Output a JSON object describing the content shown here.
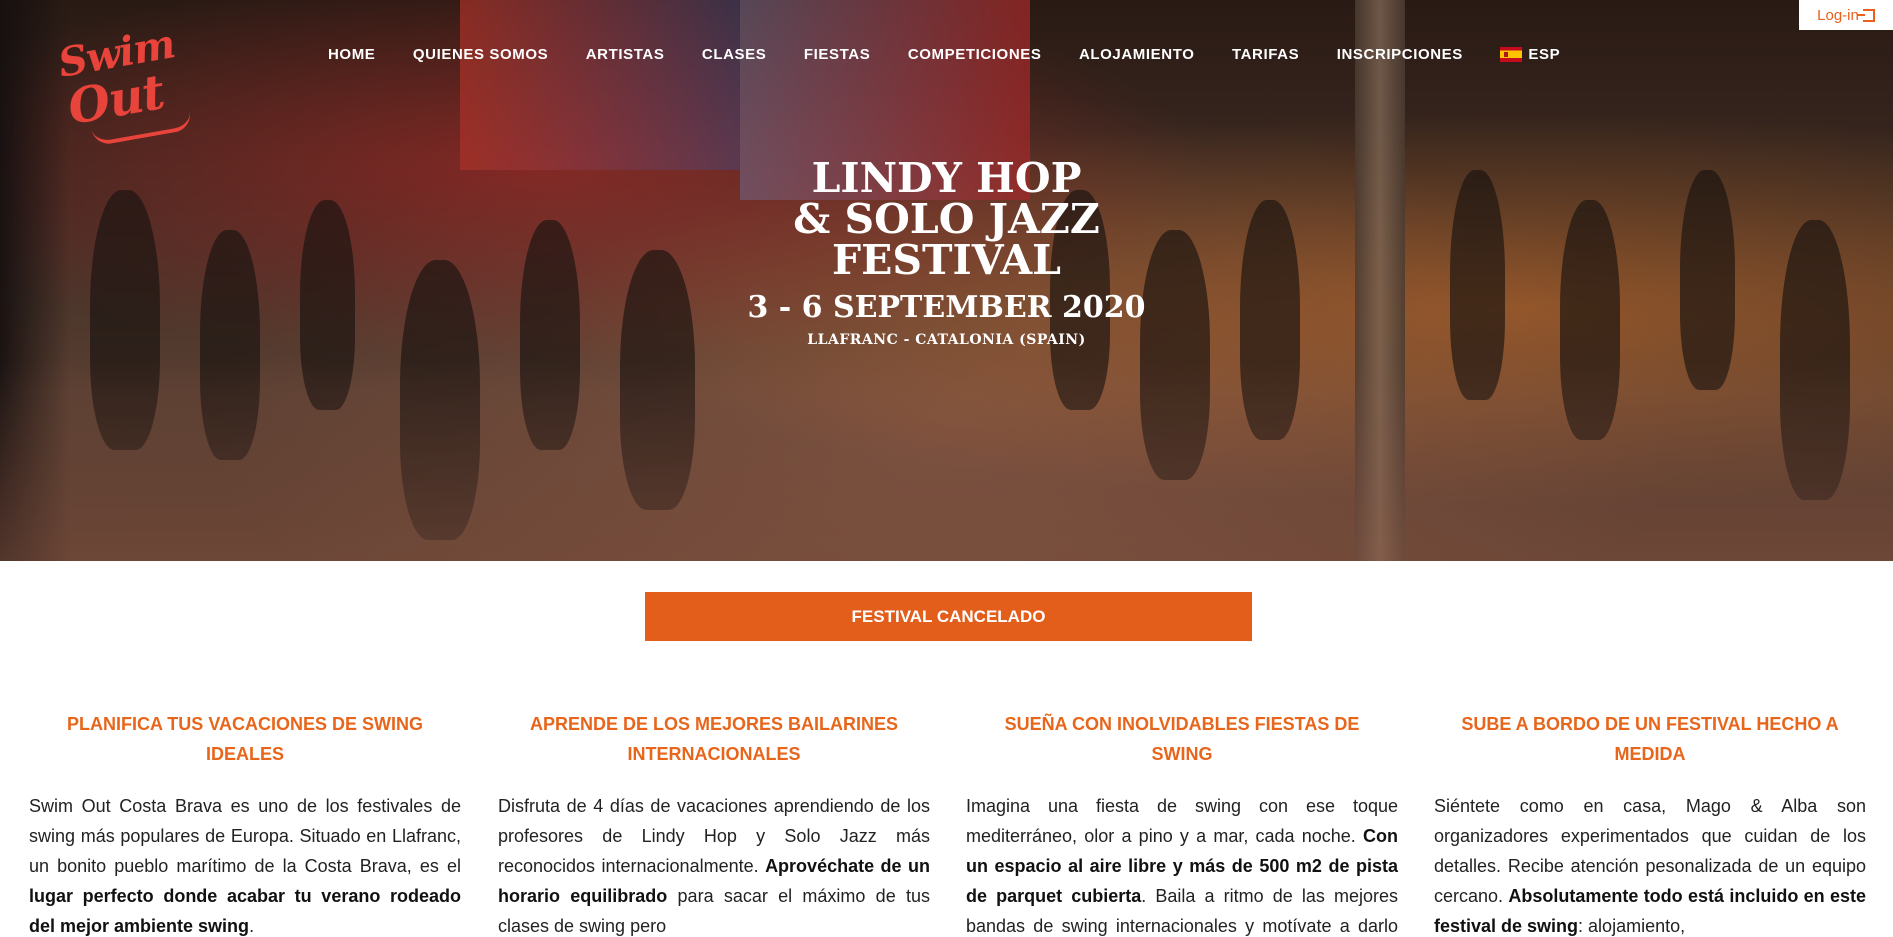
{
  "login": {
    "label": "Log-in",
    "icon": "login-icon"
  },
  "logo": {
    "line1": "Swim",
    "line2": "Out",
    "color": "#e9443b"
  },
  "nav": {
    "items": [
      "HOME",
      "QUIENES SOMOS",
      "ARTISTAS",
      "CLASES",
      "FIESTAS",
      "COMPETICIONES",
      "ALOJAMIENTO",
      "TARIFAS",
      "INSCRIPCIONES"
    ],
    "language": {
      "label": "ESP",
      "icon": "spain-flag-icon"
    }
  },
  "hero": {
    "title_line1": "LINDY HOP",
    "title_line2": "& SOLO JAZZ",
    "title_line3": "FESTIVAL",
    "dates": "3 - 6 SEPTEMBER 2020",
    "location": "LLAFRANC - CATALONIA (SPAIN)"
  },
  "banner": {
    "label": "FESTIVAL CANCELADO",
    "color": "#e35d1b"
  },
  "columns": [
    {
      "heading": "PLANIFICA TUS VACACIONES DE SWING IDEALES",
      "p1": "Swim Out Costa Brava es uno de los festivales de swing más populares de Europa. Situado en Llafranc, un bonito pueblo marítimo de la Costa Brava, es el ",
      "b1": "lugar perfecto donde acabar tu verano rodeado del mejor ambiente swing",
      "p2": "."
    },
    {
      "heading": "APRENDE DE LOS MEJORES BAILARINES INTERNACIONALES",
      "p1": "Disfruta de 4 días de vacaciones aprendiendo de los profesores de Lindy Hop y Solo Jazz más reconocidos internacionalmente. ",
      "b1": "Aprovéchate de un horario equilibrado",
      "p2": " para sacar el máximo de tus clases de swing pero"
    },
    {
      "heading": "SUEÑA CON INOLVIDABLES FIESTAS DE SWING",
      "p1": "Imagina una fiesta de swing con ese toque mediterráneo, olor a pino y a mar, cada noche. ",
      "b1": "Con un espacio al aire libre y más de 500 m2 de pista de parquet cubierta",
      "p2": ". Baila a ritmo de las mejores bandas de swing internacionales y motívate a darlo todo en las competiciones. El"
    },
    {
      "heading": "SUBE A BORDO DE UN FESTIVAL HECHO A MEDIDA",
      "p1": "Siéntete como en casa, Mago & Alba son organizadores experimentados que cuidan de los detalles. Recibe atención pesonalizada de un equipo cercano. ",
      "b1": "Absolutamente todo está incluido en este festival de swing",
      "p2": ": alojamiento,"
    }
  ],
  "colors": {
    "accent": "#e8661b"
  }
}
